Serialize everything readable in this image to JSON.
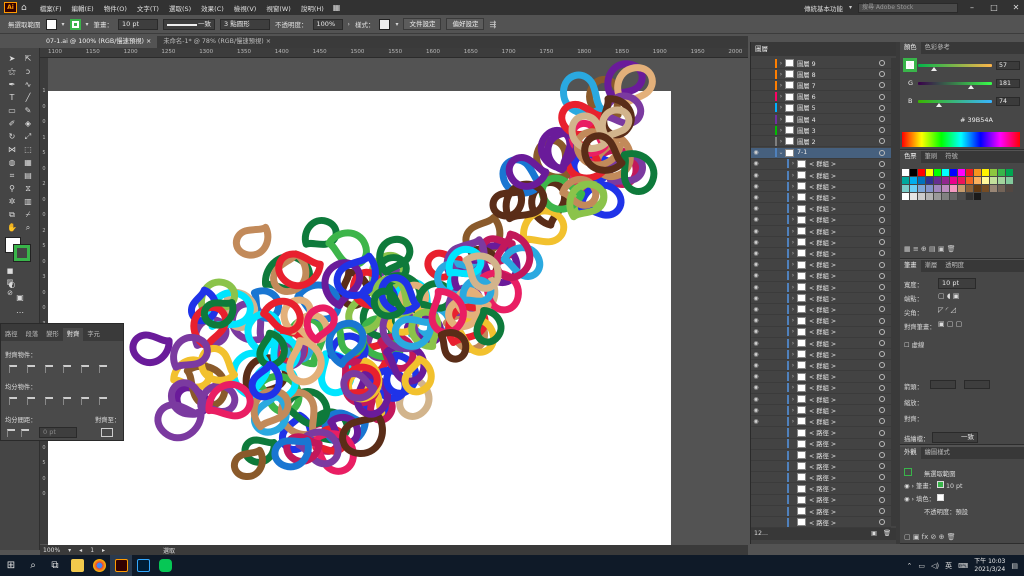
{
  "menubar": {
    "logo": "Ai",
    "menus": [
      "檔案(F)",
      "編輯(E)",
      "物件(O)",
      "文字(T)",
      "選取(S)",
      "效果(C)",
      "檢視(V)",
      "視窗(W)",
      "說明(H)"
    ],
    "workspace": "傳統基本功能",
    "stock_placeholder": "搜尋 Adobe Stock"
  },
  "control": {
    "selection": "無選取範圍",
    "stroke_label": "筆畫：",
    "stroke_value": "10 pt",
    "brush_label": "一致",
    "profile": "3 點圓形",
    "opacity_label": "不透明度：",
    "opacity_value": "100%",
    "style_label": "樣式：",
    "doc_setup": "文件設定",
    "preferences": "偏好設定",
    "colors": {
      "fill": "#ffffff",
      "stroke": "#39b54a"
    }
  },
  "tabs": [
    {
      "label": "07-1.ai @ 100% (RGB/慢速預視)",
      "close": "×"
    },
    {
      "label": "未命名-1* @ 78% (RGB/慢速預視)",
      "close": "×"
    }
  ],
  "ruler": [
    "1100",
    "1150",
    "1200",
    "1250",
    "1300",
    "1350",
    "1400",
    "1450",
    "1500",
    "1550",
    "1600",
    "1650",
    "1700",
    "1750",
    "1800",
    "1850",
    "1900",
    "1950",
    "2000"
  ],
  "ruler_v": [
    "1",
    "0",
    "0",
    "1",
    "5",
    "0",
    "2",
    "0",
    "0",
    "2",
    "5",
    "0",
    "3",
    "0",
    "0",
    "3",
    "5",
    "0",
    "4",
    "0",
    "0",
    "4",
    "5",
    "0",
    "5",
    "0",
    "0"
  ],
  "statusbar": {
    "zoom": "100%",
    "page": "1",
    "tool": "選取"
  },
  "align_panel": {
    "tabs": [
      "路徑",
      "段落",
      "變形",
      "對齊",
      "字元"
    ],
    "align_objects": "對齊物件：",
    "distribute_objects": "均分物件：",
    "distribute_spacing": "均分間距：",
    "align_to": "對齊至：",
    "spacing_value": "0 pt"
  },
  "layers": {
    "title": "圖層",
    "items": [
      {
        "name": "圖層 9",
        "color": "#ff7f00",
        "expanded": false
      },
      {
        "name": "圖層 8",
        "color": "#ff7f00",
        "expanded": false
      },
      {
        "name": "圖層 7",
        "color": "#ff7f00",
        "expanded": false
      },
      {
        "name": "圖層 6",
        "color": "#ff0066",
        "expanded": false
      },
      {
        "name": "圖層 5",
        "color": "#00b0ff",
        "expanded": false
      },
      {
        "name": "圖層 4",
        "color": "#7030a0",
        "expanded": false
      },
      {
        "name": "圖層 3",
        "color": "#00c000",
        "expanded": false
      },
      {
        "name": "圖層 2",
        "color": "#7f7f7f",
        "expanded": false
      },
      {
        "name": "7-1",
        "color": "#4f81bd",
        "expanded": true
      }
    ],
    "group_label": "< 群組 >",
    "path_label": "< 路徑 >",
    "group_count": 24,
    "path_count": 9,
    "footer": "12..."
  },
  "color_panel": {
    "tabs": [
      "顏色",
      "色彩參考"
    ],
    "r": "57",
    "g": "181",
    "b": "74",
    "hex": "39B54A",
    "r_level": 0.22,
    "g_level": 0.71,
    "b_level": 0.29
  },
  "swatches_panel": {
    "tabs": [
      "色票",
      "筆刷",
      "符號"
    ],
    "colors": [
      "#ffffff",
      "#000000",
      "#ff0000",
      "#ffff00",
      "#00ff00",
      "#00ffff",
      "#0000ff",
      "#ff00ff",
      "#ed1c24",
      "#f7941d",
      "#fff200",
      "#8dc63f",
      "#39b54a",
      "#00a651",
      "#00a99d",
      "#00aeef",
      "#0072bc",
      "#2e3192",
      "#662d91",
      "#92278f",
      "#ec008c",
      "#ed145b",
      "#f26522",
      "#fbaf5d",
      "#fff799",
      "#c4df9b",
      "#a3d39c",
      "#82ca9c",
      "#7accc8",
      "#6dcff6",
      "#7da7d9",
      "#8393ca",
      "#a186be",
      "#bd8cbf",
      "#f49ac1",
      "#c69c6d",
      "#8c6239",
      "#603913",
      "#754c24",
      "#998675",
      "#736357",
      "#534741",
      "#ffffff",
      "#e6e6e6",
      "#cccccc",
      "#b3b3b3",
      "#999999",
      "#808080",
      "#666666",
      "#4d4d4d",
      "#333333",
      "#1a1a1a"
    ]
  },
  "stroke_panel": {
    "tabs": [
      "筆畫",
      "漸層",
      "透明度"
    ],
    "weight_label": "寬度：",
    "weight_value": "10 pt",
    "cap_label": "端點：",
    "corner_label": "尖角：",
    "align_label": "對齊筆畫：",
    "dashed_label": "虛線",
    "arrow_label": "箭頭：",
    "scale_label": "縮放：",
    "align2_label": "對齊：",
    "profile_label": "描繪檔：",
    "profile_value": "一致"
  },
  "appearance_panel": {
    "tabs": [
      "外觀",
      "繪圖樣式"
    ],
    "title": "無選取範圍",
    "stroke_label": "筆畫：",
    "stroke_value": "10 pt",
    "fill_label": "填色：",
    "opacity_label": "不透明度：",
    "opacity_value": "預設"
  },
  "taskbar": {
    "time": "下午 10:03",
    "date": "2021/3/24",
    "lang": "英"
  },
  "artwork": {
    "palette": [
      "#1f33e8",
      "#e8202e",
      "#3db54a",
      "#2aa9e0",
      "#5a2d18",
      "#e3b07a",
      "#c28a5a",
      "#7b3aa0",
      "#0e7a3b",
      "#f2c12e",
      "#e91e63",
      "#00e5ff",
      "#8a5a2b",
      "#c2185b",
      "#8bc34a",
      "#1976d2",
      "#d2b48c",
      "#6a1b9a"
    ]
  }
}
